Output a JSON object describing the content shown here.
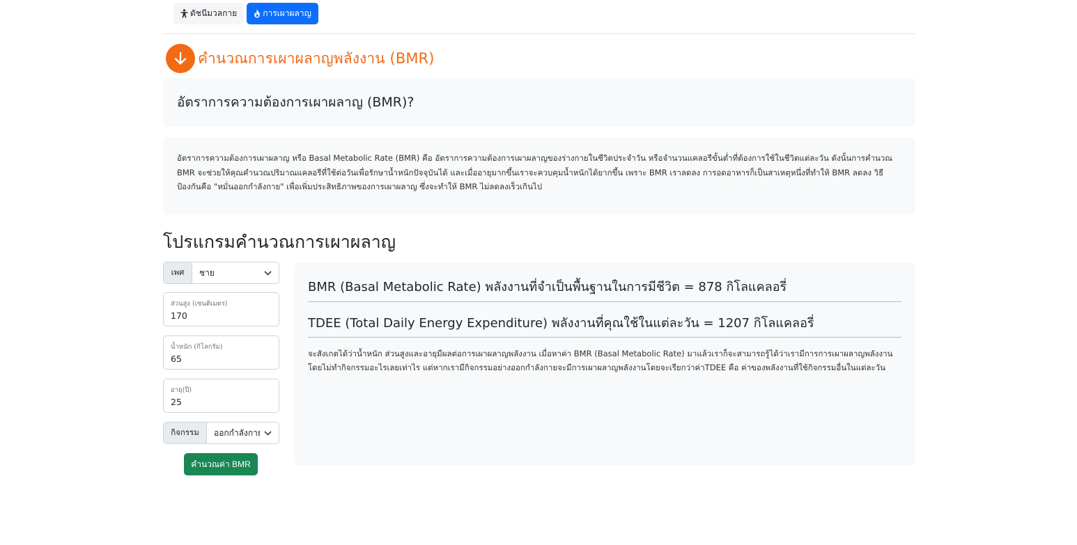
{
  "tabs": [
    {
      "label": "ดัชนีมวลกาย",
      "icon": "person-icon",
      "active": false
    },
    {
      "label": "การเผาผลาญ",
      "icon": "fire-icon",
      "active": true
    }
  ],
  "heading": {
    "icon": "arrow-down-circle-icon",
    "title": "คำนวณการเผาผลาญพลังงาน (BMR)",
    "color": "#f06a1a"
  },
  "question": "อัตราการความต้องการเผาผลาญ (BMR)?",
  "description": "อัตราการความต้องการเผาผลาญ หรือ Basal Metabolic Rate (BMR) คือ อัตราการความต้องการเผาผลาญของร่างกายในชีวิตประจำวัน หรือจำนวนแคลอรีขั้นต่ำที่ต้องการใช้ในชีวิตแต่ละวัน ดังนั้นการคำนวณ BMR จะช่วยให้คุณคำนวณปริมาณแคลอรีที่ใช้ต่อวันเพื่อรักษาน้ำหนักปัจจุบันได้ และเมื่ออายุมากขึ้นเราจะควบคุมน้ำหนักได้ยากขึ้น เพราะ BMR เราลดลง การอดอาหารก็เป็นสาเหตุหนึ่งที่ทำให้ BMR ลดลง วิธีป้องกันคือ \"หมั่นออกกำลังกาย\" เพื่อเพิ่มประสิทธิภาพของการเผาผลาญ ซึ่งจะทำให้ BMR ไม่ลดลงเร็วเกินไป",
  "program_title": "โปรแกรมคำนวณการเผาผลาญ",
  "form": {
    "gender": {
      "label": "เพศ",
      "value": "ชาย"
    },
    "height": {
      "label": "ส่วนสูง (เซนติเมตร)",
      "value": "170"
    },
    "weight": {
      "label": "น้ำหนัก (กิโลกรัม)",
      "value": "65"
    },
    "age": {
      "label": "อายุ(ปี)",
      "value": "25"
    },
    "activity": {
      "label": "กิจกรรม",
      "value": "ออกกำลังกาย"
    },
    "submit_label": "คำนวณค่า BMR"
  },
  "result": {
    "bmr_line": "BMR (Basal Metabolic Rate) พลังงานที่จำเป็นพื้นฐานในการมีชีวิต = 878 กิโลแคลอรี่",
    "tdee_line": "TDEE (Total Daily Energy Expenditure) พลังงานที่คุณใช้ในแต่ละวัน = 1207 กิโลแคลอรี่",
    "note": "จะสังเกตได้ว่าน้ำหนัก ส่วนสูงและอายุมีผลต่อการเผาผลาญพลังงาน เมื่อหาค่า BMR (Basal Metabolic Rate) มาแล้วเราก็จะสามารถรู้ได้ว่าเรามีการการเผาผลาญพลังงานโดยไม่ทำกิจกรรมอะไรเลยเท่าไร แต่หากเรามีกิจกรรมอย่างออกกำลังกายจะมีการเผาผลาญพลังงานโดยจะเรียกว่าค่าTDEE คือ ค่าของพลังงานที่ใช้กิจกรรมอื่นในแต่ละวัน"
  },
  "colors": {
    "primary": "#0d6efd",
    "accent": "#f26a13",
    "success": "#198754"
  }
}
